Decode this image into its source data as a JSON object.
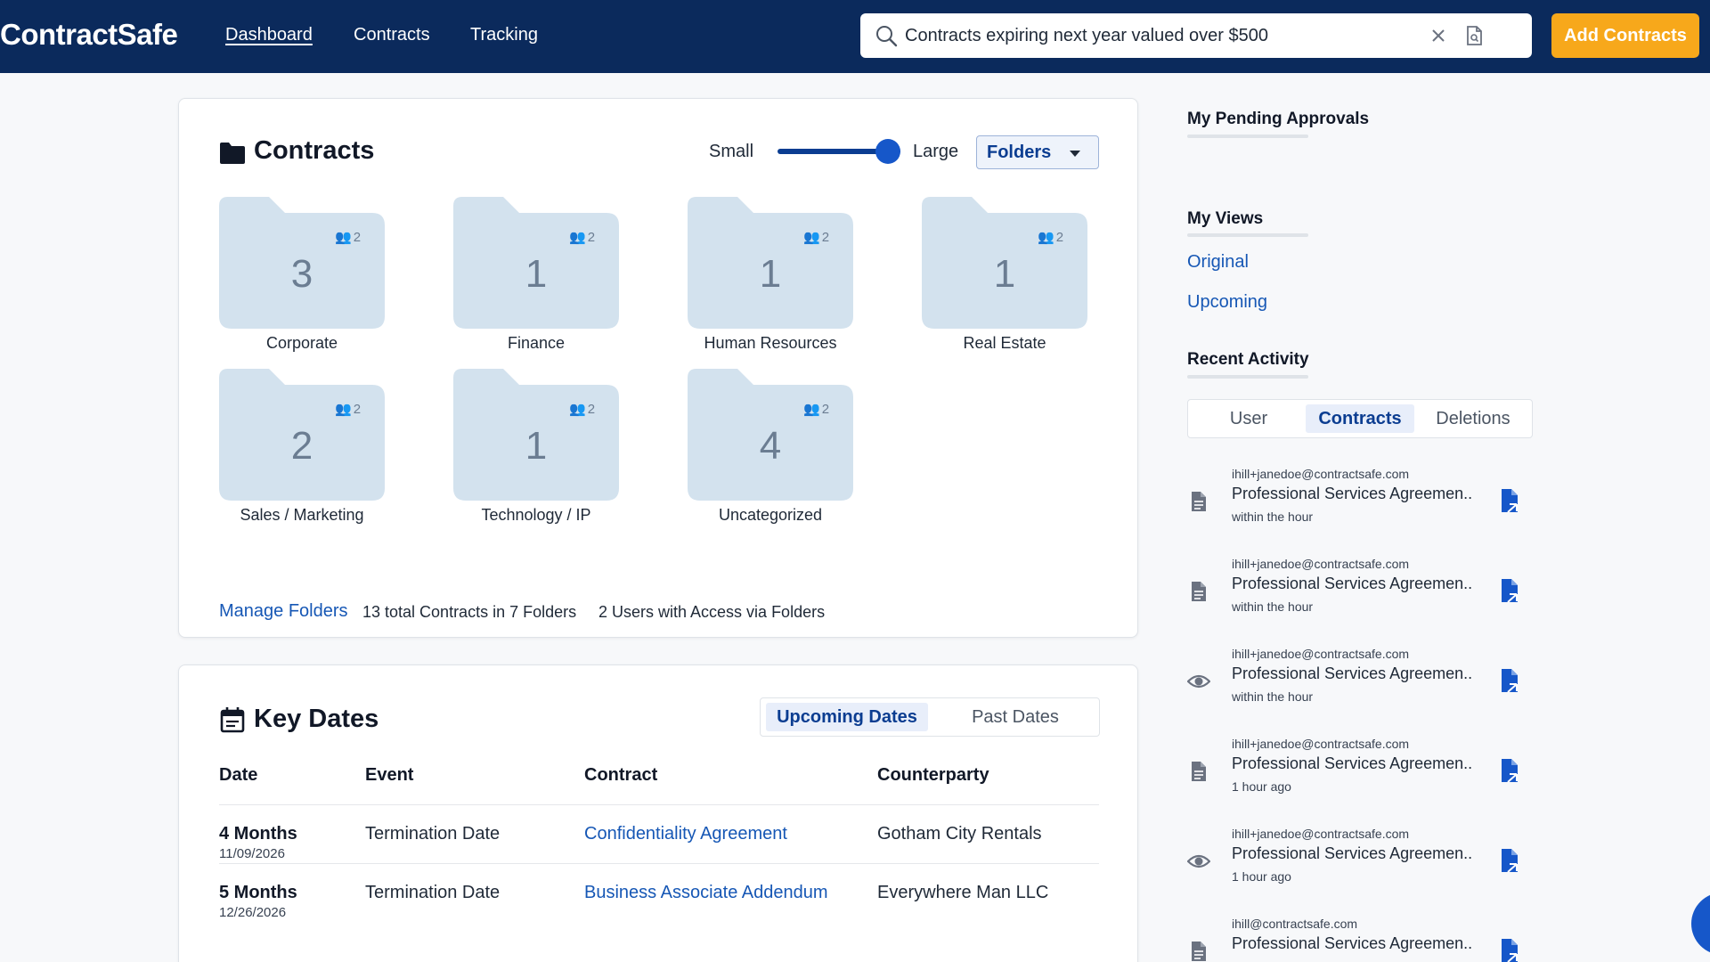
{
  "topbar": {
    "logo": "ContractSafe",
    "nav": [
      "Dashboard",
      "Contracts",
      "Tracking"
    ],
    "search_value": "Contracts expiring next year valued over $500",
    "add_button": "Add Contracts"
  },
  "contracts_card": {
    "title": "Contracts",
    "size_small": "Small",
    "size_large": "Large",
    "size_level": 1.0,
    "view_select": "Folders",
    "folders": [
      {
        "name": "Corporate",
        "count": "3",
        "users": "2"
      },
      {
        "name": "Finance",
        "count": "1",
        "users": "2"
      },
      {
        "name": "Human Resources",
        "count": "1",
        "users": "2"
      },
      {
        "name": "Real Estate",
        "count": "1",
        "users": "2"
      },
      {
        "name": "Sales / Marketing",
        "count": "2",
        "users": "2"
      },
      {
        "name": "Technology / IP",
        "count": "1",
        "users": "2"
      },
      {
        "name": "Uncategorized",
        "count": "4",
        "users": "2"
      }
    ],
    "manage_link": "Manage Folders",
    "total_text": "13 total Contracts in 7 Folders",
    "users_text": "2 Users with Access via Folders"
  },
  "key_dates": {
    "title": "Key Dates",
    "tabs": [
      "Upcoming Dates",
      "Past Dates"
    ],
    "columns": [
      "Date",
      "Event",
      "Contract",
      "Counterparty"
    ],
    "rows": [
      {
        "relative": "4 Months",
        "date": "11/09/2026",
        "event": "Termination Date",
        "contract": "Confidentiality Agreement",
        "counterparty": "Gotham City Rentals"
      },
      {
        "relative": "5 Months",
        "date": "12/26/2026",
        "event": "Termination Date",
        "contract": "Business Associate Addendum",
        "counterparty": "Everywhere Man LLC"
      }
    ]
  },
  "sidebar": {
    "pending_title": "My Pending Approvals",
    "views_title": "My Views",
    "views": [
      "Original",
      "Upcoming"
    ],
    "activity_title": "Recent Activity",
    "activity_tabs": [
      "User",
      "Contracts",
      "Deletions"
    ],
    "activity": [
      {
        "email": "ihill+janedoe@contractsafe.com",
        "title": "Professional Services Agreemen...",
        "time": "within the hour",
        "icon": "document-icon"
      },
      {
        "email": "ihill+janedoe@contractsafe.com",
        "title": "Professional Services Agreemen...",
        "time": "within the hour",
        "icon": "document-icon"
      },
      {
        "email": "ihill+janedoe@contractsafe.com",
        "title": "Professional Services Agreemen...",
        "time": "within the hour",
        "icon": "eye-icon"
      },
      {
        "email": "ihill+janedoe@contractsafe.com",
        "title": "Professional Services Agreemen...",
        "time": "1 hour ago",
        "icon": "document-icon"
      },
      {
        "email": "ihill+janedoe@contractsafe.com",
        "title": "Professional Services Agreemen...",
        "time": "1 hour ago",
        "icon": "eye-icon"
      },
      {
        "email": "ihill@contractsafe.com",
        "title": "Professional Services Agreemen...",
        "time": "",
        "icon": "document-icon"
      }
    ]
  },
  "colors": {
    "topbar": "#0b2a5c",
    "accent": "#f7a81b",
    "link": "#1657b5",
    "folder": "#d3e2ee"
  }
}
